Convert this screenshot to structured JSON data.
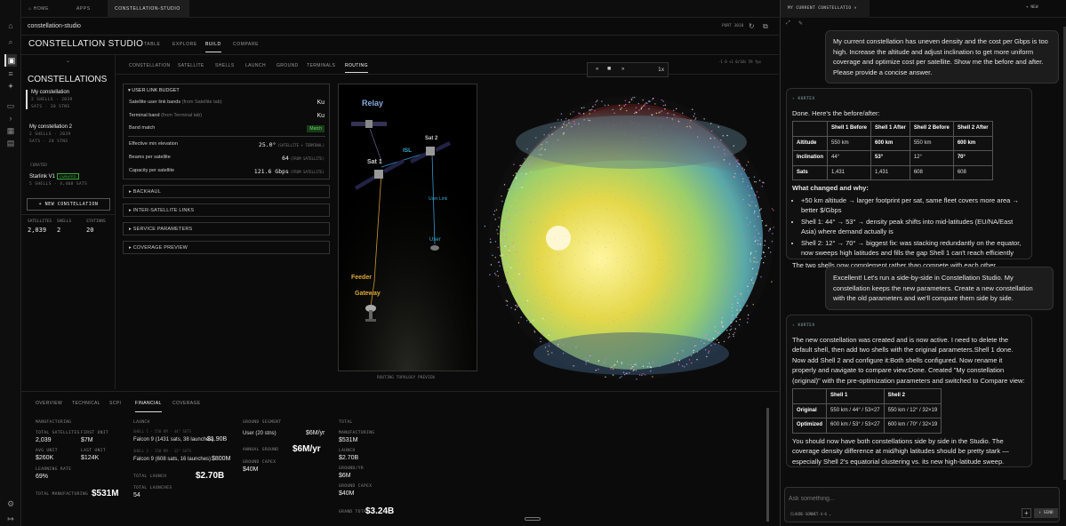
{
  "top_tabs": [
    "HOME",
    "APPS",
    "CONSTELLATION-STUDIO"
  ],
  "breadcrumb": "constellation-studio",
  "crumb_right": "PORT 3010",
  "studio": {
    "title": "CONSTELLATION STUDIO",
    "tabs": [
      "TABLE",
      "EXPLORE",
      "BUILD",
      "COMPARE"
    ],
    "active": "BUILD"
  },
  "left": {
    "heading": "CONSTELLATIONS",
    "items": [
      {
        "name": "My constellation",
        "sub1": "2 SHELLS · 2039",
        "sub2": "SATS · 20 STNS"
      },
      {
        "name": "My constellation 2",
        "sub1": "2 SHELLS · 2039",
        "sub2": "SATS · 20 STNS"
      }
    ],
    "curated_label": "CURATED",
    "curated": {
      "name": "Starlink V1",
      "badge": "CURATED",
      "sub": "5 SHELLS · 4,408 SATS"
    },
    "new_button": "+ NEW CONSTELLATION",
    "stats": [
      {
        "label": "SATELLITES",
        "value": "2,039"
      },
      {
        "label": "SHELLS",
        "value": "2"
      },
      {
        "label": "STATIONS",
        "value": "20"
      }
    ]
  },
  "subtabs": [
    "CONSTELLATION",
    "SATELLITE",
    "SHELLS",
    "LAUNCH",
    "GROUND",
    "TERMINALS",
    "ROUTING"
  ],
  "budget": {
    "title": "USER LINK BUDGET",
    "rows": [
      {
        "label": "Satellite user link bands",
        "note": "(from Satellite tab)",
        "value": "Ku"
      },
      {
        "label": "Terminal band",
        "note": "(from Terminal tab)",
        "value": "Ku"
      },
      {
        "label": "Band match",
        "note": "",
        "value": "Match"
      }
    ],
    "rows2": [
      {
        "label": "Effective min elevation",
        "value": "25.0°",
        "note": "(SATELLITE + TERMINAL)"
      },
      {
        "label": "Beams per satellite",
        "value": "64",
        "note": "(FROM SATELLITE)"
      },
      {
        "label": "Capacity per satellite",
        "value": "121.6 Gbps",
        "note": "(FROM SATELLITE)"
      }
    ]
  },
  "sections": [
    "BACKHAUL",
    "INTER-SATELLITE LINKS",
    "SERVICE PARAMETERS",
    "COVERAGE PREVIEW"
  ],
  "diagram": {
    "relay": "Relay",
    "sat1": "Sat 1",
    "sat2": "Sat 2",
    "isl": "ISL",
    "user_link": "User Link",
    "user": "User",
    "feeder": "Feeder",
    "gateway": "Gateway",
    "caption": "ROUTING TOPOLOGY PREVIEW"
  },
  "player": {
    "speed": "1x"
  },
  "globe_status": "-1 0 +1  0/10s  59 fps",
  "bottom": {
    "tabs": [
      "OVERVIEW",
      "TECHNICAL",
      "SCPI",
      "FINANCIAL",
      "COVERAGE"
    ],
    "active": "FINANCIAL",
    "mfg": {
      "title": "MANUFACTURING",
      "total_sats_l": "TOTAL SATELLITES",
      "total_sats": "2,039",
      "first_l": "FIRST UNIT",
      "first": "$7M",
      "avg_l": "AVG UNIT",
      "avg": "$260K",
      "last_l": "LAST UNIT",
      "last": "$124K",
      "lr_l": "LEARNING RATE",
      "lr": "69%",
      "tm_l": "TOTAL MANUFACTURING",
      "tm": "$531M"
    },
    "launch": {
      "title": "LAUNCH",
      "s1_note": "SHELL 1 · 550 KM · 44° SATS",
      "s1": "Falcon 9 (1431 sats, 38 launches)",
      "s1v": "$1.90B",
      "s2_note": "SHELL 2 · 550 KM · 12° SATS",
      "s2": "Falcon 9 (608 sats, 16 launches)",
      "s2v": "$800M",
      "tl_l": "TOTAL LAUNCH",
      "tl": "$2.70B",
      "tlc_l": "TOTAL LAUNCHES",
      "tlc": "54"
    },
    "ground": {
      "title": "GROUND SEGMENT",
      "user_l": "User (20 stns)",
      "user": "$6M/yr",
      "annual_l": "ANNUAL GROUND",
      "annual": "$6M/yr",
      "capex_l": "GROUND CAPEX",
      "capex": "$40M"
    },
    "total": {
      "title": "TOTAL",
      "mfg_l": "MANUFACTURING",
      "mfg": "$531M",
      "launch_l": "LAUNCH",
      "launch": "$2.70B",
      "gy_l": "GROUND/YR",
      "gy": "$6M",
      "gc_l": "GROUND CAPEX",
      "gc": "$40M",
      "grand_l": "GRAND TOTAL",
      "grand": "$3.24B"
    }
  },
  "chat": {
    "tab": "MY CURRENT CONSTELLATIO",
    "new": "+ NEW",
    "u1": "My current constellation has uneven density and the cost per Gbps is too high. Increase the altitude and adjust inclination to get more uniform coverage and optimize cost per satellite. Show me the before and after. Please provide a concise answer.",
    "agent": "KORTEX",
    "a1_intro": "Done. Here's the before/after:",
    "t1_head": [
      "",
      "Shell 1 Before",
      "Shell 1 After",
      "Shell 2 Before",
      "Shell 2 After"
    ],
    "t1_rows": [
      [
        "Altitude",
        "550 km",
        "600 km",
        "550 km",
        "600 km"
      ],
      [
        "Inclination",
        "44°",
        "53°",
        "12°",
        "70°"
      ],
      [
        "Sats",
        "1,431",
        "1,431",
        "608",
        "608"
      ]
    ],
    "a1_what": "What changed and why:",
    "b1": "+50 km altitude → larger footprint per sat, same fleet covers more area → better $/Gbps",
    "b2": "Shell 1: 44° → 53° → density peak shifts into mid-latitudes (EU/NA/East Asia) where demand actually is",
    "b3": "Shell 2: 12° → 70° → biggest fix: was stacking redundantly on the equator, now sweeps high latitudes and fills the gap Shell 1 can't reach efficiently",
    "a1_end": "The two shells now complement rather than compete with each other.",
    "u2": "Excellent! Let's run a side-by-side in Constellation Studio. My constellation keeps the new parameters. Create a new constellation with the old parameters and we'll compare them side by side.",
    "a2_text": "The new constellation was created and is now active. I need to delete the default shell, then add two shells with the original parameters.Shell 1 done. Now add Shell 2 and configure it:Both shells configured. Now rename it properly and navigate to compare view:Done. Created \"My constellation (original)\" with the pre-optimization parameters and switched to Compare view:",
    "t2_head": [
      "",
      "Shell 1",
      "Shell 2"
    ],
    "t2_rows": [
      [
        "Original",
        "550 km / 44° / 53×27",
        "550 km / 12° / 32×19"
      ],
      [
        "Optimized",
        "600 km / 53° / 53×27",
        "600 km / 70° / 32×19"
      ]
    ],
    "a2_end": "You should now have both constellations side by side in the Studio. The coverage density difference at mid/high latitudes should be pretty stark — especially Shell 2's equatorial clustering vs. its new high-latitude sweep.",
    "placeholder": "Ask something...",
    "model": "CLAUDE-SONNET-4-6",
    "send": "SEND"
  }
}
